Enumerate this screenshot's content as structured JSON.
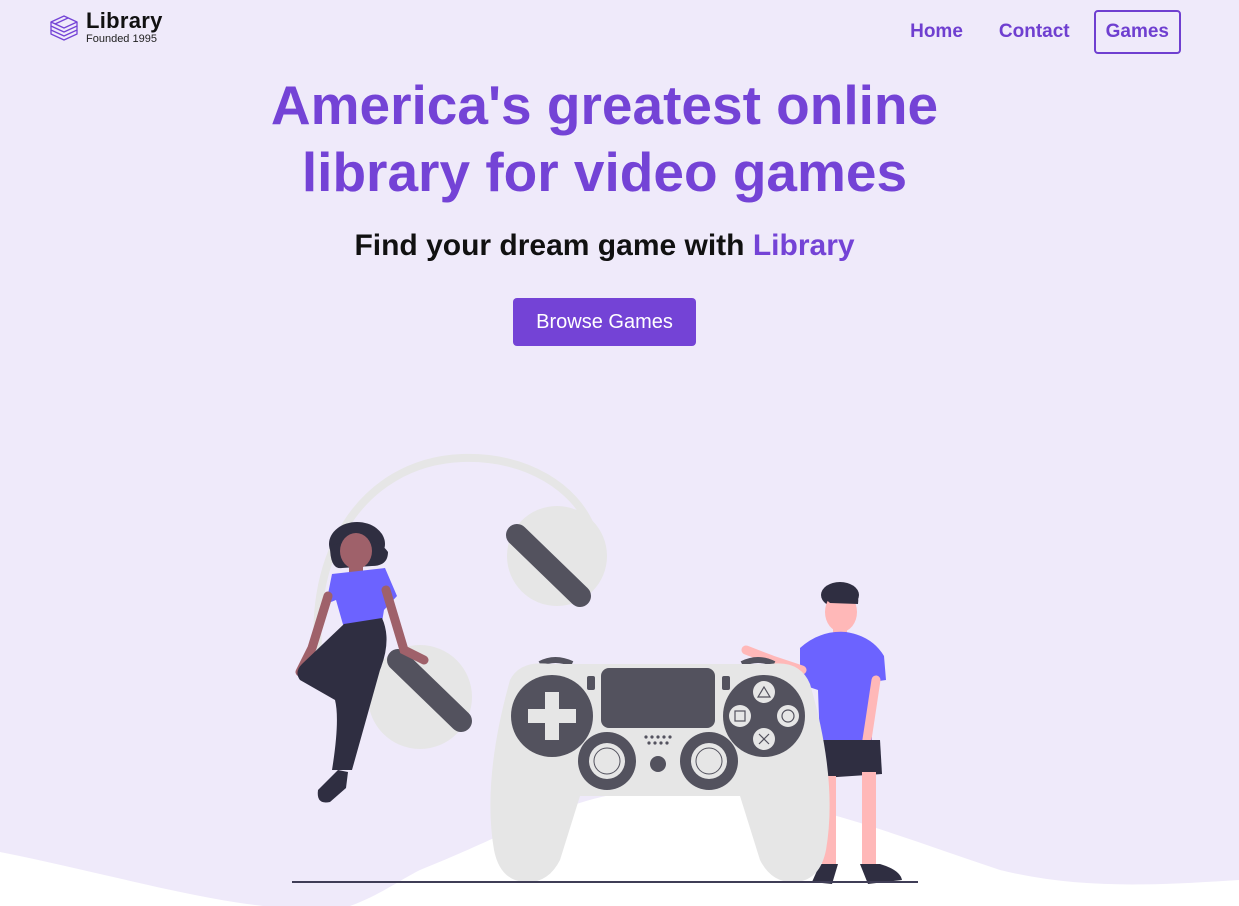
{
  "header": {
    "logo": {
      "title": "Library",
      "subtitle": "Founded 1995",
      "icon": "books-stack-icon"
    },
    "nav": [
      {
        "label": "Home",
        "active": false
      },
      {
        "label": "Contact",
        "active": false
      },
      {
        "label": "Games",
        "active": true
      }
    ]
  },
  "hero": {
    "title_line1": "America's greatest online",
    "title_line2": "library for video games",
    "subtitle_prefix": "Find your dream game with ",
    "subtitle_accent": "Library",
    "cta_label": "Browse Games"
  },
  "illustration": {
    "icon": "gamers-with-controller-illustration"
  },
  "colors": {
    "accent": "#7443d6",
    "background": "#efeafa",
    "figure_shirt": "#6c63ff",
    "controller_dark": "#53525e",
    "controller_light": "#e6e6e6"
  }
}
